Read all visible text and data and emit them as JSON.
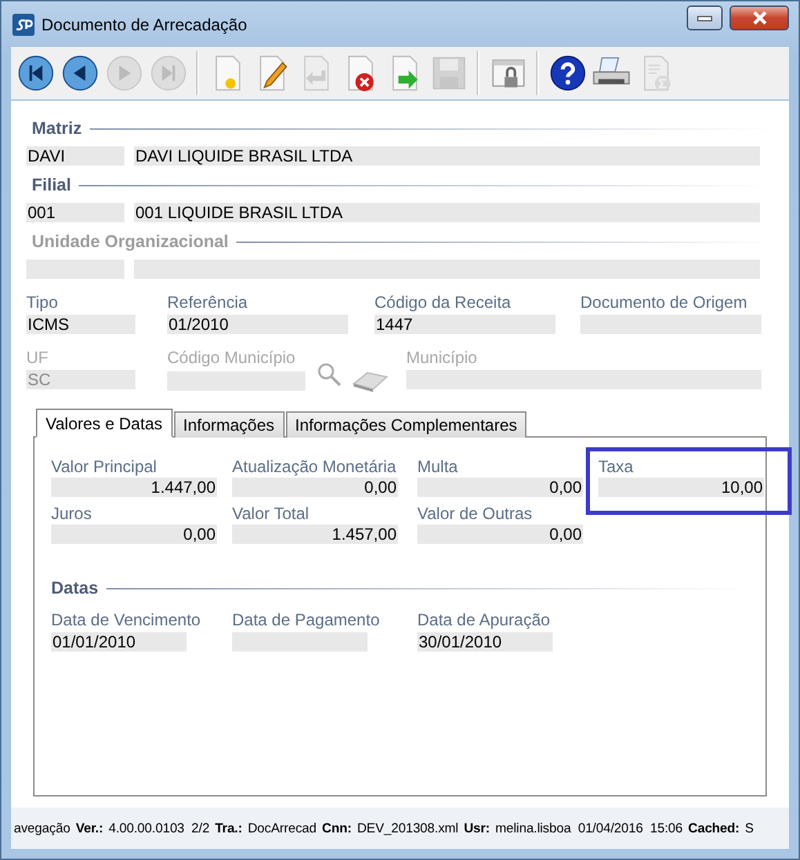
{
  "window": {
    "title": "Documento de Arrecadação"
  },
  "toolbar": [
    [
      {
        "kind": "first",
        "disabled": false
      },
      {
        "kind": "previous",
        "disabled": false
      },
      {
        "kind": "next",
        "disabled": true
      },
      {
        "kind": "last",
        "disabled": true
      }
    ],
    [
      {
        "kind": "new",
        "disabled": false
      },
      {
        "kind": "edit",
        "disabled": false
      },
      {
        "kind": "undo",
        "disabled": true
      },
      {
        "kind": "delete",
        "disabled": false
      },
      {
        "kind": "export",
        "disabled": false
      },
      {
        "kind": "save",
        "disabled": true
      }
    ],
    [
      {
        "kind": "lock",
        "disabled": false
      }
    ],
    [
      {
        "kind": "help",
        "disabled": false
      },
      {
        "kind": "print",
        "disabled": false
      },
      {
        "kind": "sum",
        "disabled": true
      }
    ]
  ],
  "groups": [
    {
      "title": "Matriz",
      "disabled": false,
      "code": "DAVI",
      "name": "DAVI LIQUIDE BRASIL LTDA"
    },
    {
      "title": "Filial",
      "disabled": false,
      "code": "001",
      "name": "001 LIQUIDE BRASIL LTDA"
    },
    {
      "title": "Unidade Organizacional",
      "disabled": true
    }
  ],
  "fields_row_1": [
    {
      "label": "Tipo",
      "value": "ICMS",
      "disabled": false
    },
    {
      "label": "Referência",
      "value": "01/2010",
      "disabled": false
    },
    {
      "label": "Código da Receita",
      "value": "1447",
      "disabled": false
    },
    {
      "label": "Documento de Origem",
      "disabled": false
    }
  ],
  "fields_row_2": [
    {
      "label": "UF",
      "value": "SC",
      "disabled": true
    },
    {
      "label": "Código Município",
      "disabled": true
    },
    {
      "label": "Município",
      "disabled": true
    }
  ],
  "tabs": [
    {
      "label": "Valores e Datas",
      "selected": true
    },
    {
      "label": "Informações",
      "selected": false
    },
    {
      "label": "Informações Complementares",
      "selected": false
    }
  ],
  "values": [
    {
      "label": "Valor Principal",
      "value": "1.447,00",
      "highlighted": false
    },
    {
      "label": "Atualização Monetária",
      "value": "0,00",
      "highlighted": false
    },
    {
      "label": "Multa",
      "value": "0,00",
      "highlighted": false
    },
    {
      "label": "Taxa",
      "value": "10,00",
      "highlighted": true
    },
    {
      "label": "Juros",
      "value": "0,00",
      "highlighted": false
    },
    {
      "label": "Valor Total",
      "value": "1.457,00",
      "highlighted": false
    },
    {
      "label": "Valor de Outras",
      "value": "0,00",
      "highlighted": false
    }
  ],
  "dates_title": "Datas",
  "dates": [
    {
      "label": "Data de Vencimento",
      "value": "01/01/2010"
    },
    {
      "label": "Data de Pagamento"
    },
    {
      "label": "Data de Apuração",
      "value": "30/01/2010"
    }
  ],
  "status_bar": [
    {
      "text": "avegação",
      "bold": false
    },
    {
      "text": "Ver.:",
      "bold": true
    },
    {
      "text": "4.00.00.0103  2/2",
      "bold": false
    },
    {
      "text": "Tra.:",
      "bold": true
    },
    {
      "text": "DocArrecad",
      "bold": false
    },
    {
      "text": "Cnn:",
      "bold": true
    },
    {
      "text": "DEV_201308.xml",
      "bold": false
    },
    {
      "text": "Usr:",
      "bold": true
    },
    {
      "text": "melina.lisboa  01/04/2016  15:06",
      "bold": false
    },
    {
      "text": "Cached:",
      "bold": true
    },
    {
      "text": "S",
      "bold": false
    }
  ]
}
